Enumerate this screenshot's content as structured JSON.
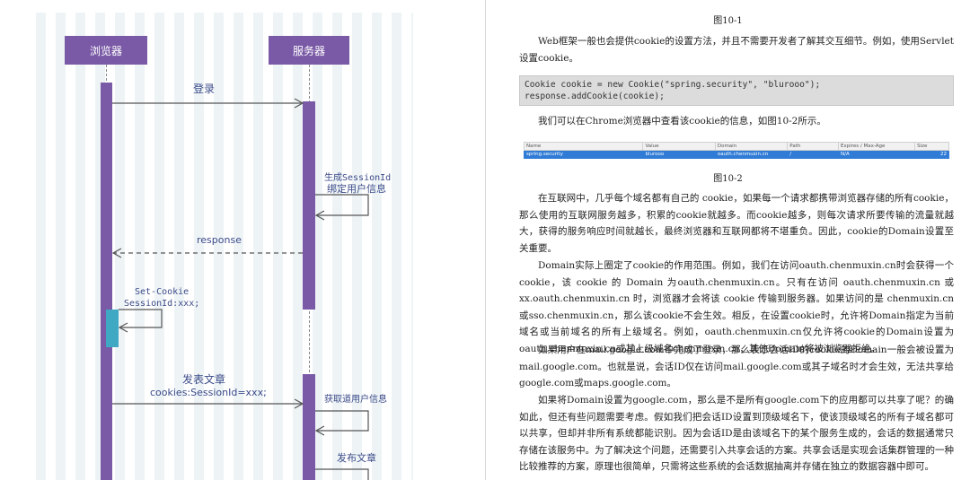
{
  "diagram": {
    "actors": {
      "browser": "浏览器",
      "server": "服务器"
    },
    "messages": {
      "login": "登录",
      "gen_session_1": "生成SessionId",
      "gen_session_2": "绑定用户信息",
      "response": "response",
      "set_cookie_1": "Set-Cookie",
      "set_cookie_2": "SessionId:xxx;",
      "publish_1": "发表文章",
      "publish_2": "cookies:SessionId=xxx;",
      "get_user": "获取道用户信息",
      "publish_article": "发布文章"
    }
  },
  "doc": {
    "fig1_caption": "图10-1",
    "para1": "Web框架一般也会提供cookie的设置方法，并且不需要开发者了解其交互细节。例如，使用Servlet设置cookie。",
    "code": [
      "Cookie cookie = new Cookie(\"spring.security\", \"blurooo\");",
      "response.addCookie(cookie);"
    ],
    "para2": "我们可以在Chrome浏览器中查看该cookie的信息，如图10-2所示。",
    "table": {
      "headers": [
        "Name",
        "Value",
        "Domain",
        "Path",
        "Expires / Max-Age",
        "Size"
      ],
      "row": [
        "spring.security",
        "blurooo",
        "oauth.chenmuxin.cn",
        "/",
        "N/A",
        "22"
      ]
    },
    "fig2_caption": "图10-2",
    "para3": "在互联网中，几乎每个域名都有自己的 cookie，如果每一个请求都携带浏览器存储的所有cookie，那么使用的互联网服务越多，积累的cookie就越多。而cookie越多，则每次请求所要传输的流量就越大，获得的服务响应时间就越长，最终浏览器和互联网都将不堪重负。因此，cookie的Domain设置至关重要。",
    "para4": "Domain实际上圈定了cookie的作用范围。例如，我们在访问oauth.chenmuxin.cn时会获得一个cookie，该 cookie 的 Domain 为oauth.chenmuxin.cn。只有在访问 oauth.chenmuxin.cn 或xx.oauth.chenmuxin.cn 时，浏览器才会将该 cookie 传输到服务器。如果访问的是 chenmuxin.cn或sso.chenmuxin.cn，那么该cookie不会生效。相反，在设置cookie时，允许将Domain指定为当前域名或当前域名的所有上级域名。例如，oauth.chenmuxin.cn仅允许将cookie的Domain设置为oauth.chenmuxin.cn或其上级域名chenmuxin.cn，其他Domain将被浏览器拒绝。",
    "para5": "如果用户在mail.google.com中完成了登录，那么表示会话ID的cookie的Domain一般会被设置为mail.google.com。也就是说，会话ID仅在访问mail.google.com或其子域名时才会生效，无法共享给google.com或maps.google.com。",
    "para6": "如果将Domain设置为google.com，那么是不是所有google.com下的应用都可以共享了呢？的确如此，但还有些问题需要考虑。假如我们把会话ID设置到顶级域名下，使该顶级域名的所有子域名都可以共享，但却并非所有系统都能识别。因为会话ID是由该域名下的某个服务生成的，会话的数据通常只存储在该服务中。为了解决这个问题，还需要引入共享会话的方案。共享会话是实现会话集群管理的一种比较推荐的方案，原理也很简单，只需将这些系统的会话数据抽离并存储在独立的数据容器中即可。"
  }
}
